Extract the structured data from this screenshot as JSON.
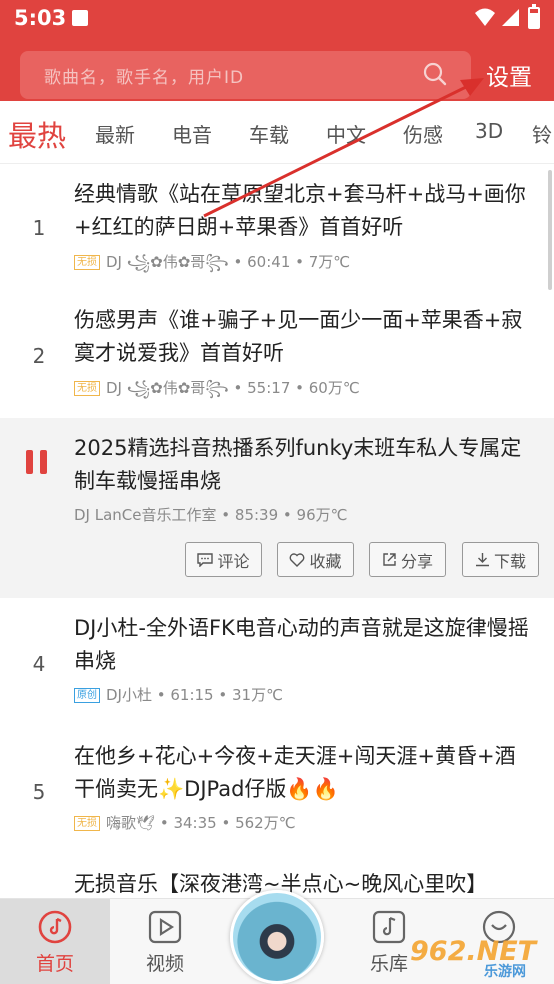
{
  "status_bar": {
    "time": "5:03"
  },
  "header": {
    "search_placeholder": "歌曲名，歌手名，用户ID",
    "settings_label": "设置"
  },
  "tabs": [
    "最热",
    "最新",
    "电音",
    "车载",
    "中文",
    "伤感",
    "3D",
    "铃"
  ],
  "songs": [
    {
      "index": "1",
      "title": "经典情歌《站在草原望北京+套马杆+战马+画你+红红的萨日朗+苹果香》首首好听",
      "badge": "无损",
      "artist": "DJ ꧁✿伟✿哥꧂",
      "duration": "60:41",
      "plays": "7万℃"
    },
    {
      "index": "2",
      "title": "伤感男声《谁+骗子+见一面少一面+苹果香+寂寞才说爱我》首首好听",
      "badge": "无损",
      "artist": "DJ ꧁✿伟✿哥꧂",
      "duration": "55:17",
      "plays": "60万℃"
    },
    {
      "index": "",
      "title": "2025精选抖音热播系列funky末班车私人专属定制车载慢摇串烧",
      "badge": "",
      "artist": "DJ LanCe音乐工作室",
      "duration": "85:39",
      "plays": "96万℃"
    },
    {
      "index": "4",
      "title": "DJ小杜-全外语FK电音心动的声音就是这旋律慢摇串烧",
      "badge": "原创",
      "artist": "DJ小杜",
      "duration": "61:15",
      "plays": "31万℃"
    },
    {
      "index": "5",
      "title": "在他乡+花心+今夜+走天涯+闯天涯+黄昏+酒干倘卖无✨DJPad仔版🔥🔥",
      "badge": "无损",
      "artist": "嗨歌🕊",
      "duration": "34:35",
      "plays": "562万℃"
    },
    {
      "index": "",
      "title": "无损音乐【深夜港湾~半点心~晚风心里吹】",
      "badge": "",
      "artist": "",
      "duration": "",
      "plays": ""
    }
  ],
  "actions": {
    "comment": "评论",
    "favorite": "收藏",
    "share": "分享",
    "download": "下载"
  },
  "bottom_nav": {
    "home": "首页",
    "video": "视频",
    "library": "乐库"
  },
  "watermark": {
    "main": "962.NET",
    "sub": "乐游网"
  },
  "colors": {
    "brand_red": "#e0433f",
    "badge_lossless": "#f0b64b",
    "badge_original": "#3aa0e0"
  }
}
